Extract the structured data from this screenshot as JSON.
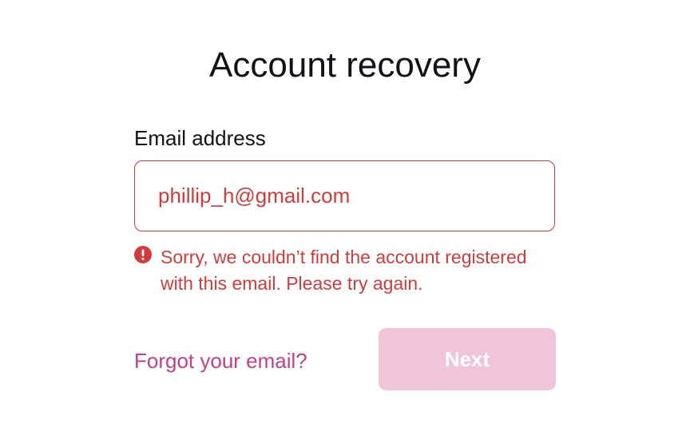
{
  "page": {
    "title": "Account recovery"
  },
  "form": {
    "email_label": "Email address",
    "email_value": "phillip_h@gmail.com",
    "error_icon": "error-circle-exclamation-icon",
    "error_message": "Sorry, we couldn’t find the account registered with this email. Please try again.",
    "forgot_label": "Forgot your email?",
    "next_label": "Next",
    "next_disabled": true
  },
  "colors": {
    "text": "#111118",
    "error": "#d23b3b",
    "link": "#c43f86",
    "button_disabled_bg": "#f1c5d9",
    "button_text": "#ffffff"
  }
}
